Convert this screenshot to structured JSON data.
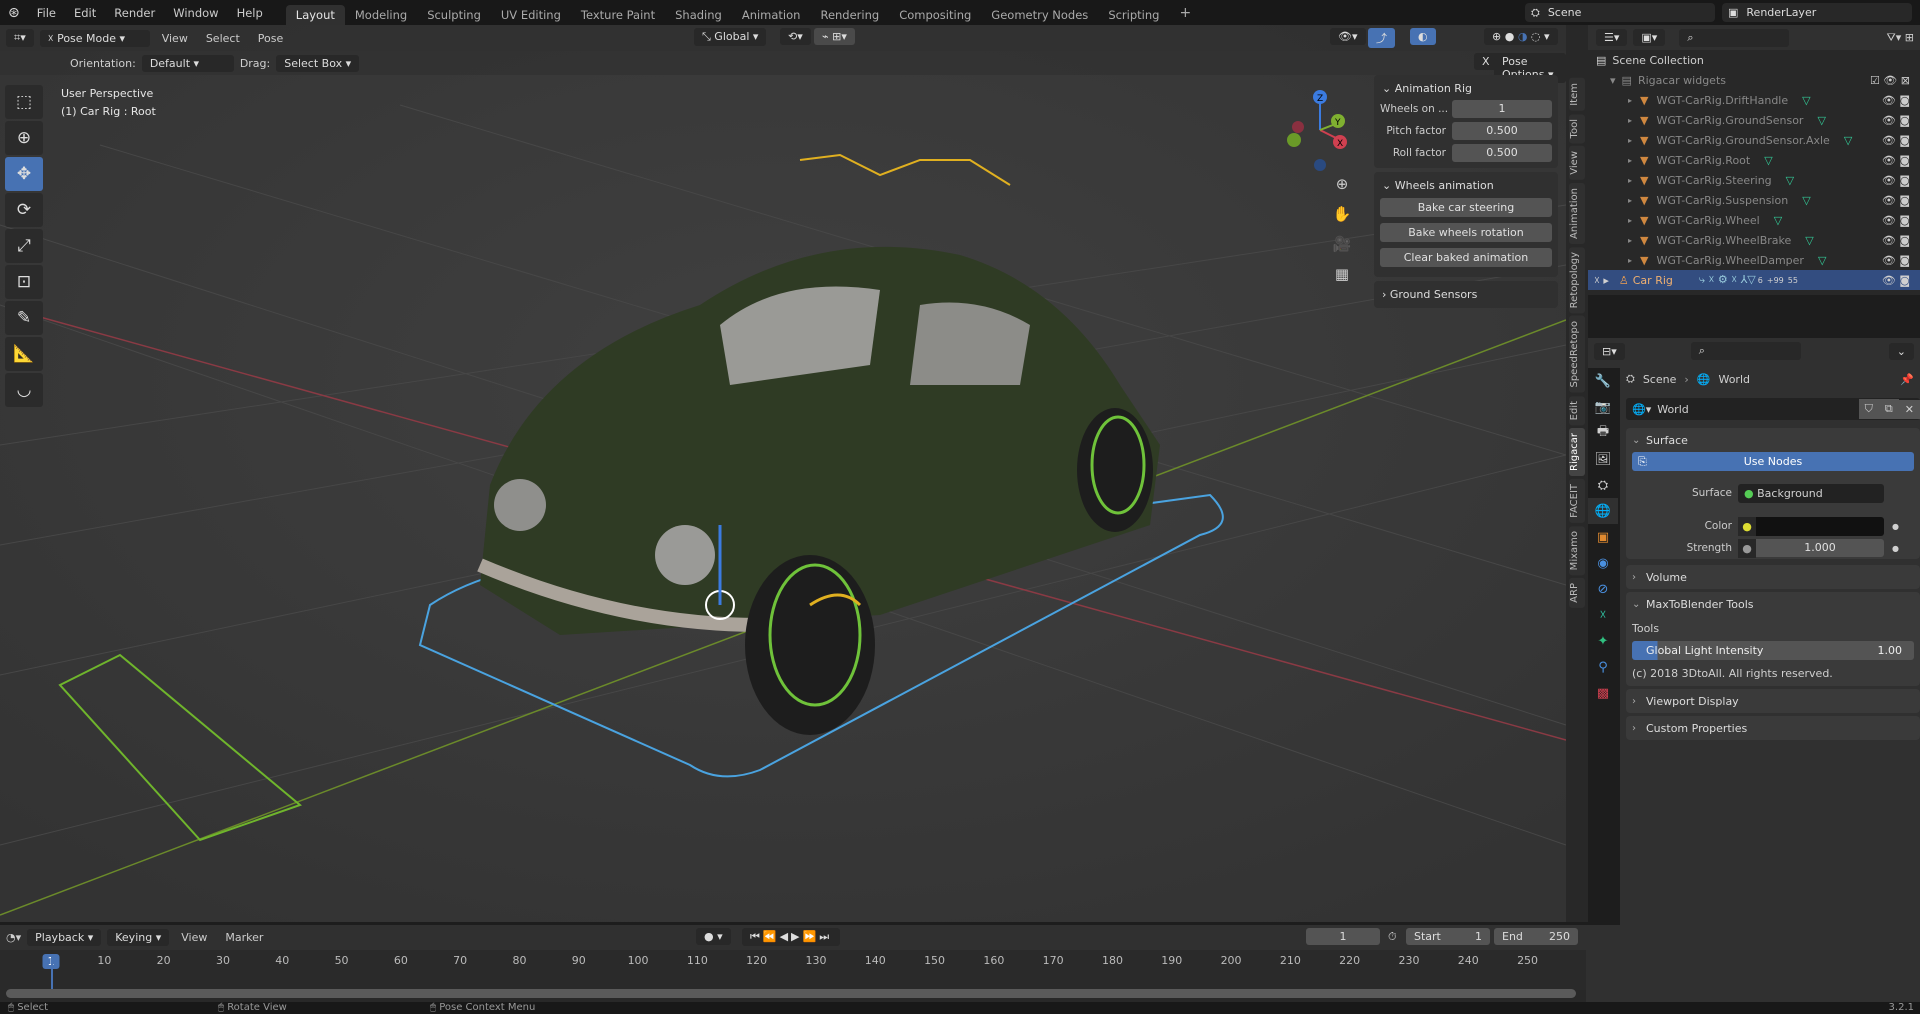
{
  "topbar": {
    "menus": [
      "File",
      "Edit",
      "Render",
      "Window",
      "Help"
    ],
    "workspaces": [
      "Layout",
      "Modeling",
      "Sculpting",
      "UV Editing",
      "Texture Paint",
      "Shading",
      "Animation",
      "Rendering",
      "Compositing",
      "Geometry Nodes",
      "Scripting"
    ],
    "add": "+",
    "scene": "Scene",
    "render_layer": "RenderLayer"
  },
  "viewport": {
    "mode": "Pose Mode",
    "menus": [
      "View",
      "Select",
      "Pose"
    ],
    "orientation_label": "Orientation:",
    "orientation": "Default",
    "drag_label": "Drag:",
    "drag": "Select Box",
    "transform": "Global",
    "x_mirror": "X",
    "pose_options": "Pose Options",
    "overlay_title": "User Perspective",
    "overlay_sub": "(1) Car Rig : Root",
    "gizmo": {
      "x": "X",
      "y": "Y",
      "z": "Z"
    }
  },
  "npanel": {
    "anim_rig": {
      "title": "Animation Rig",
      "rows": [
        {
          "label": "Wheels on ...",
          "value": "1"
        },
        {
          "label": "Pitch factor",
          "value": "0.500"
        },
        {
          "label": "Roll factor",
          "value": "0.500"
        }
      ]
    },
    "wheels": {
      "title": "Wheels animation",
      "buttons": [
        "Bake car steering",
        "Bake wheels rotation",
        "Clear baked animation"
      ]
    },
    "ground": {
      "title": "Ground Sensors"
    },
    "tabs": [
      "Item",
      "Tool",
      "View",
      "Animation",
      "Retopology",
      "SpeedRetopo",
      "Edit",
      "Rigacar",
      "FACEIT",
      "Mixamo",
      "ARP"
    ],
    "active_tab": "Rigacar"
  },
  "outliner": {
    "root": "Scene Collection",
    "collection": "Rigacar widgets",
    "items": [
      "WGT-CarRig.DriftHandle",
      "WGT-CarRig.GroundSensor",
      "WGT-CarRig.GroundSensor.Axle",
      "WGT-CarRig.Root",
      "WGT-CarRig.Steering",
      "WGT-CarRig.Suspension",
      "WGT-CarRig.Wheel",
      "WGT-CarRig.WheelBrake",
      "WGT-CarRig.WheelDamper"
    ],
    "selected": "Car Rig",
    "badges": [
      "6",
      "+99",
      "55"
    ]
  },
  "properties": {
    "breadcrumb": [
      "Scene",
      "World"
    ],
    "world_name": "World",
    "surface": {
      "title": "Surface",
      "use_nodes": "Use Nodes",
      "surface_label": "Surface",
      "surface_value": "Background",
      "color_label": "Color",
      "strength_label": "Strength",
      "strength": "1.000"
    },
    "volume": "Volume",
    "maxtoblender": {
      "title": "MaxToBlender Tools",
      "tools_label": "Tools",
      "slider_label": "Global Light Intensity",
      "slider_value": "1.00",
      "copyright": "(c) 2018 3DtoAll. All rights reserved."
    },
    "viewport_display": "Viewport Display",
    "custom_props": "Custom Properties"
  },
  "timeline": {
    "menus": [
      "Playback",
      "Keying",
      "View",
      "Marker"
    ],
    "current_frame": "1",
    "start_label": "Start",
    "start": "1",
    "end_label": "End",
    "end": "250",
    "ticks": [
      "1",
      "10",
      "20",
      "30",
      "40",
      "50",
      "60",
      "70",
      "80",
      "90",
      "100",
      "110",
      "120",
      "130",
      "140",
      "150",
      "160",
      "170",
      "180",
      "190",
      "200",
      "210",
      "220",
      "230",
      "240",
      "250"
    ]
  },
  "status": {
    "items": [
      "Select",
      "Rotate View",
      "Pose Context Menu"
    ],
    "version": "3.2.1"
  },
  "colors": {
    "accent": "#4772b3",
    "selected": "#334d80"
  }
}
